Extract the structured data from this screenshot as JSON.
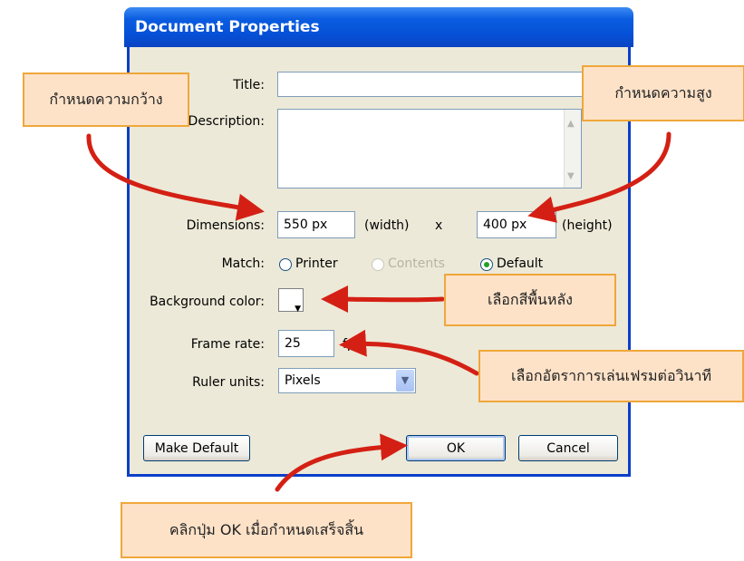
{
  "dialog": {
    "title": "Document Properties",
    "labels": {
      "title": "Title:",
      "description": "Description:",
      "dimensions": "Dimensions:",
      "match": "Match:",
      "background_color": "Background color:",
      "frame_rate": "Frame rate:",
      "ruler_units": "Ruler units:"
    },
    "fields": {
      "title_value": "",
      "description_value": "",
      "width_value": "550 px",
      "height_value": "400 px",
      "frame_rate_value": "25",
      "frame_rate_unit": "fps",
      "ruler_units_value": "Pixels"
    },
    "width_suffix": "(width)",
    "times": "x",
    "height_suffix": "(height)",
    "match_options": [
      {
        "label": "Printer",
        "selected": false,
        "enabled": true
      },
      {
        "label": "Contents",
        "selected": false,
        "enabled": false
      },
      {
        "label": "Default",
        "selected": true,
        "enabled": true
      }
    ],
    "background_color": "#ffffff",
    "buttons": {
      "make_default": "Make Default",
      "ok": "OK",
      "cancel": "Cancel"
    }
  },
  "callouts": {
    "width": "กำหนดความกว้าง",
    "height": "กำหนดความสูง",
    "bg_color": "เลือกสีพื้นหลัง",
    "frame_rate": "เลือกอัตราการเล่นเฟรมต่อวินาที",
    "ok": "คลิกปุ่ม OK เมื่อกำหนดเสร็จสิ้น"
  },
  "colors": {
    "arrow": "#d42014",
    "callout_bg": "#fde2c8",
    "callout_border": "#f0a73a",
    "titlebar": "#0a5ce0"
  }
}
